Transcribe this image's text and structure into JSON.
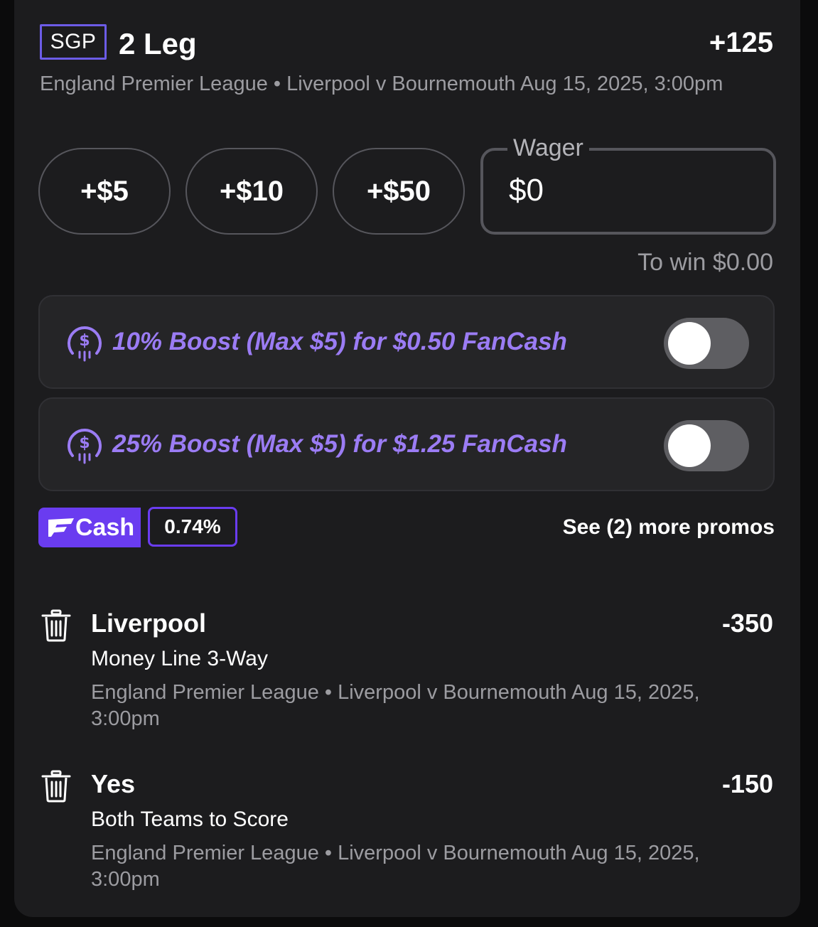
{
  "header": {
    "badge": "SGP",
    "title": "2 Leg",
    "odds": "+125",
    "event": "England Premier League • Liverpool v Bournemouth Aug 15, 2025, 3:00pm"
  },
  "wager": {
    "chips": [
      "+$5",
      "+$10",
      "+$50"
    ],
    "label": "Wager",
    "value": "$0",
    "to_win": "To win $0.00"
  },
  "boosts": [
    {
      "label": "10% Boost (Max $5) for $0.50 FanCash",
      "enabled": false,
      "icon": "fancash-coin-icon"
    },
    {
      "label": "25% Boost (Max $5) for $1.25 FanCash",
      "enabled": false,
      "icon": "fancash-coin-icon"
    }
  ],
  "fancash": {
    "badge_text": "Cash",
    "percent": "0.74%",
    "more_promos": "See (2) more promos"
  },
  "legs": [
    {
      "selection": "Liverpool",
      "odds": "-350",
      "market": "Money Line 3-Way",
      "event": "England Premier League • Liverpool v Bournemouth Aug 15, 2025, 3:00pm"
    },
    {
      "selection": "Yes",
      "odds": "-150",
      "market": "Both Teams to Score",
      "event": "England Premier League • Liverpool v Bournemouth Aug 15, 2025, 3:00pm"
    }
  ],
  "colors": {
    "accent_purple": "#6a3cf0",
    "boost_text": "#9b7cf4",
    "card_bg": "#1c1c1e",
    "muted_text": "#9c9ca1"
  }
}
